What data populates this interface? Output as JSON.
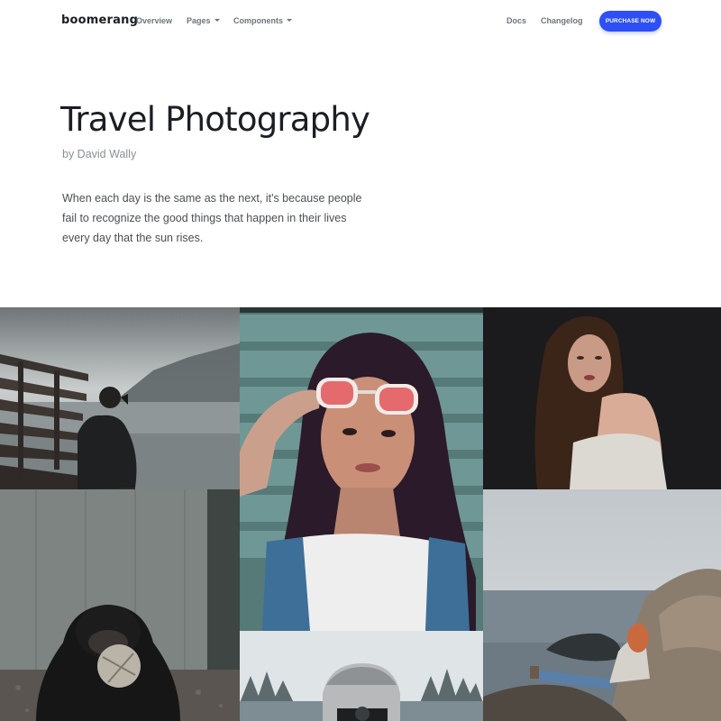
{
  "nav": {
    "brand": "boomerang",
    "items": [
      {
        "label": "Overview"
      },
      {
        "label": "Pages"
      },
      {
        "label": "Components"
      }
    ],
    "right_items": [
      {
        "label": "Docs"
      },
      {
        "label": "Changelog"
      }
    ],
    "cta": "PURCHASE NOW"
  },
  "header": {
    "title": "Travel Photography",
    "author": "by David Wally",
    "lead": "When each day is the same as the next, it's because people fail to recognize the good things that happen in their lives every day that the sun rises."
  },
  "colors": {
    "accent": "#2d4ff5",
    "title": "#1b1e24",
    "muted": "#8a9097"
  },
  "gallery": {
    "photos": [
      {
        "subject": "photographer-on-pier"
      },
      {
        "subject": "woman-with-sunglasses"
      },
      {
        "subject": "woman-portrait-dark"
      },
      {
        "subject": "chimpanzee"
      },
      {
        "subject": "woman-on-rocks-by-sea"
      },
      {
        "subject": "photographer-in-snow"
      }
    ]
  }
}
